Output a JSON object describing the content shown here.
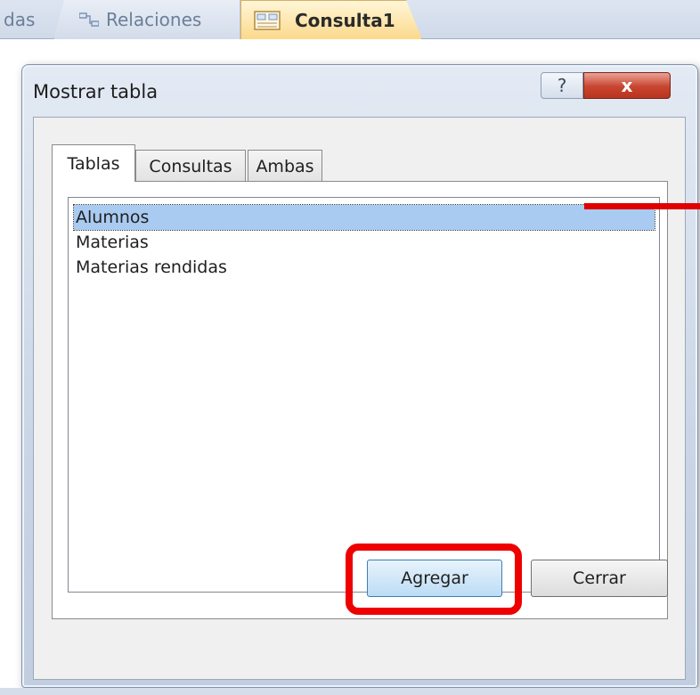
{
  "background_tabs": {
    "partial_label": "das",
    "relaciones_label": "Relaciones",
    "consulta_label": "Consulta1"
  },
  "dialog": {
    "title": "Mostrar tabla",
    "help_label": "?",
    "close_label": "x",
    "tabs": [
      {
        "label": "Tablas",
        "active": true
      },
      {
        "label": "Consultas",
        "active": false
      },
      {
        "label": "Ambas",
        "active": false
      }
    ],
    "list_items": [
      {
        "label": "Alumnos",
        "selected": true
      },
      {
        "label": "Materias",
        "selected": false
      },
      {
        "label": "Materias rendidas",
        "selected": false
      }
    ],
    "buttons": {
      "add_label": "Agregar",
      "close_label": "Cerrar"
    }
  },
  "colors": {
    "selection": "#a9cbf1",
    "annotation_red": "#ee0000",
    "close_button": "#c8452f",
    "active_doc_tab": "#fcd98b"
  },
  "icons": [
    "relationships-icon",
    "query-icon",
    "help-icon",
    "close-icon"
  ]
}
